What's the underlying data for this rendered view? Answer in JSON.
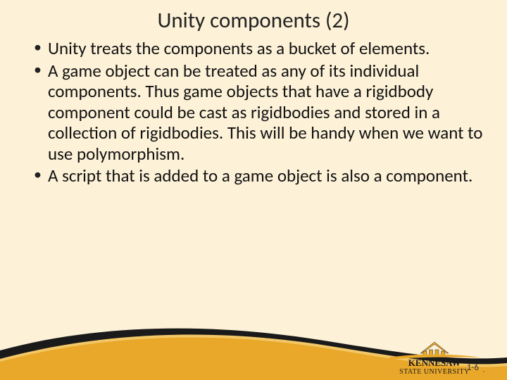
{
  "slide": {
    "title": "Unity components (2)",
    "bullets": [
      "Unity treats the components as a bucket of elements.",
      "A game object can be treated as any of its individual components.  Thus game objects that have a rigidbody component could be cast as rigidbodies and stored in a collection of rigidbodies.  This will be handy when we want to use polymorphism.",
      "A script that is added to a game object is also a component."
    ],
    "slide_number": "1-6",
    "logo": {
      "line1": "KENNESAW",
      "line2": "STATE UNIVERSITY"
    }
  }
}
